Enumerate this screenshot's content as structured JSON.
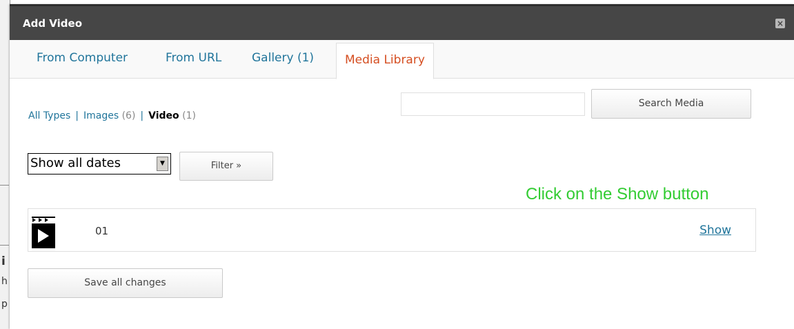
{
  "background": {
    "glyphs": [
      "i",
      "h",
      "p"
    ]
  },
  "dialog": {
    "title": "Add Video",
    "close_glyph": "×"
  },
  "tabs": [
    {
      "label": "From Computer"
    },
    {
      "label": "From URL"
    },
    {
      "label": "Gallery (1)"
    },
    {
      "label": "Media Library",
      "active": true
    }
  ],
  "type_filter": {
    "all_types": "All Types",
    "separator": "|",
    "images_label": "Images",
    "images_count": "(6)",
    "video_label": "Video",
    "video_count": "(1)"
  },
  "search": {
    "value": "",
    "button_label": "Search Media"
  },
  "date_filter": {
    "selected": "Show all dates",
    "arrow_glyph": "▼"
  },
  "filter_button_label": "Filter »",
  "annotation_text": "Click on the Show button",
  "media_items": [
    {
      "title": "01",
      "icon": "video-clapper-icon",
      "action_label": "Show"
    }
  ],
  "save_button_label": "Save all changes",
  "colors": {
    "titlebar": "#464646",
    "link": "#21759b",
    "active_tab": "#d54e21",
    "annotation": "#33cc33"
  }
}
